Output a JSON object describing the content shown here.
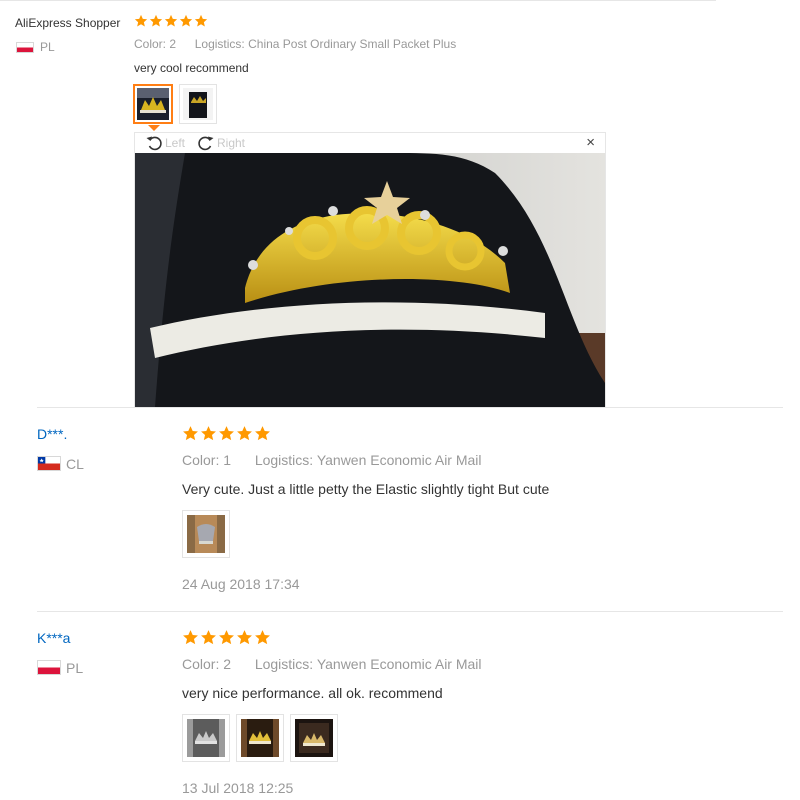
{
  "reviews": [
    {
      "user": "AliExpress Shopper",
      "country": "PL",
      "rating": 5,
      "color_label": "Color:",
      "color_value": "2",
      "logistics_label": "Logistics:",
      "logistics_value": "China Post Ordinary Small Packet Plus",
      "text": "very cool recommend",
      "photos": 2
    },
    {
      "user": "D***.",
      "country": "CL",
      "rating": 5,
      "color_label": "Color:",
      "color_value": "1",
      "logistics_label": "Logistics:",
      "logistics_value": "Yanwen Economic Air Mail",
      "text": "Very cute. Just a little petty the Elastic slightly tight But cute",
      "photos": 1,
      "date": "24 Aug 2018 17:34"
    },
    {
      "user": "K***a",
      "country": "PL",
      "rating": 5,
      "color_label": "Color:",
      "color_value": "2",
      "logistics_label": "Logistics:",
      "logistics_value": "Yanwen Economic Air Mail",
      "text": "very nice performance. all ok. recommend",
      "photos": 3,
      "date": "13 Jul 2018 12:25"
    }
  ],
  "viewer": {
    "rotate_left": "Left",
    "rotate_right": "Right",
    "close": "×"
  },
  "colors": {
    "star": "#ff9900",
    "link": "#0066c0",
    "muted": "#999999",
    "selected_thumb": "#ff7e14"
  },
  "icons": [
    "star-icon",
    "flag-pl-icon",
    "flag-cl-icon",
    "rotate-left-icon",
    "rotate-right-icon",
    "close-icon"
  ]
}
